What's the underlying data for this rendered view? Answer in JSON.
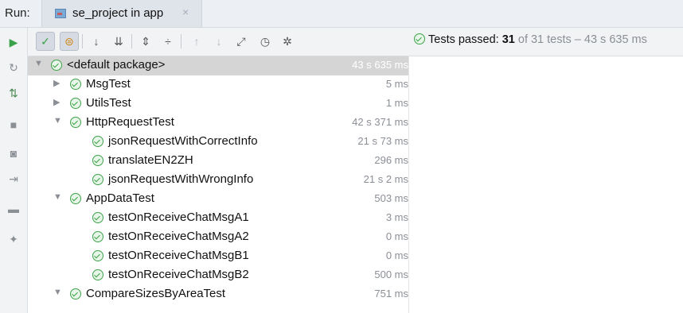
{
  "run": {
    "label": "Run:",
    "tab_title": "se_project in app",
    "tab_close": "×"
  },
  "status": {
    "prefix": "Tests passed:",
    "passed": "31",
    "suffix": "of 31 tests – 43 s 635 ms"
  },
  "colors": {
    "pass_green": "#3da24a",
    "selected_row": "#d5d5d5",
    "run_green": "#3aa24a"
  },
  "left_toolbar": [
    {
      "icon": "run-icon",
      "glyph": "▶"
    },
    {
      "icon": "rerun-failed-icon",
      "glyph": "↻"
    },
    {
      "icon": "toggle-auto-test-icon",
      "glyph": "⇅"
    },
    {
      "icon": "stop-icon",
      "glyph": "■"
    },
    {
      "icon": "camera-icon",
      "glyph": "◙"
    },
    {
      "icon": "export-icon",
      "glyph": "⇥"
    },
    {
      "icon": "layout-icon",
      "glyph": "▬"
    },
    {
      "icon": "pin-icon",
      "glyph": "✦"
    }
  ],
  "test_toolbar": [
    {
      "icon": "show-passed-icon",
      "glyph": "✓"
    },
    {
      "icon": "show-ignored-icon",
      "glyph": "⊜"
    },
    {
      "icon": "sort-alpha-icon",
      "glyph": "↓"
    },
    {
      "icon": "sort-duration-icon",
      "glyph": "⇊"
    },
    {
      "icon": "expand-all-icon",
      "glyph": "⇕"
    },
    {
      "icon": "collapse-all-icon",
      "glyph": "÷"
    },
    {
      "icon": "previous-icon",
      "glyph": "↑"
    },
    {
      "icon": "next-icon",
      "glyph": "↓"
    },
    {
      "icon": "export-results-icon",
      "glyph": "⤢"
    },
    {
      "icon": "history-icon",
      "glyph": "◷"
    },
    {
      "icon": "settings-icon",
      "glyph": "✲"
    }
  ],
  "tree": [
    {
      "name": "<default package>",
      "time": "43 s 635 ms",
      "level": 0,
      "arrow": "▼",
      "selected": true
    },
    {
      "name": "MsgTest",
      "time": "5 ms",
      "level": 1,
      "arrow": "▶"
    },
    {
      "name": "UtilsTest",
      "time": "1 ms",
      "level": 1,
      "arrow": "▶"
    },
    {
      "name": "HttpRequestTest",
      "time": "42 s 371 ms",
      "level": 1,
      "arrow": "▼"
    },
    {
      "name": "jsonRequestWithCorrectInfo",
      "time": "21 s 73 ms",
      "level": 2,
      "arrow": ""
    },
    {
      "name": "translateEN2ZH",
      "time": "296 ms",
      "level": 2,
      "arrow": ""
    },
    {
      "name": "jsonRequestWithWrongInfo",
      "time": "21 s 2 ms",
      "level": 2,
      "arrow": ""
    },
    {
      "name": "AppDataTest",
      "time": "503 ms",
      "level": 1,
      "arrow": "▼"
    },
    {
      "name": "testOnReceiveChatMsgA1",
      "time": "3 ms",
      "level": 2,
      "arrow": ""
    },
    {
      "name": "testOnReceiveChatMsgA2",
      "time": "0 ms",
      "level": 2,
      "arrow": ""
    },
    {
      "name": "testOnReceiveChatMsgB1",
      "time": "0 ms",
      "level": 2,
      "arrow": ""
    },
    {
      "name": "testOnReceiveChatMsgB2",
      "time": "500 ms",
      "level": 2,
      "arrow": ""
    },
    {
      "name": "CompareSizesByAreaTest",
      "time": "751 ms",
      "level": 1,
      "arrow": "▼"
    }
  ]
}
